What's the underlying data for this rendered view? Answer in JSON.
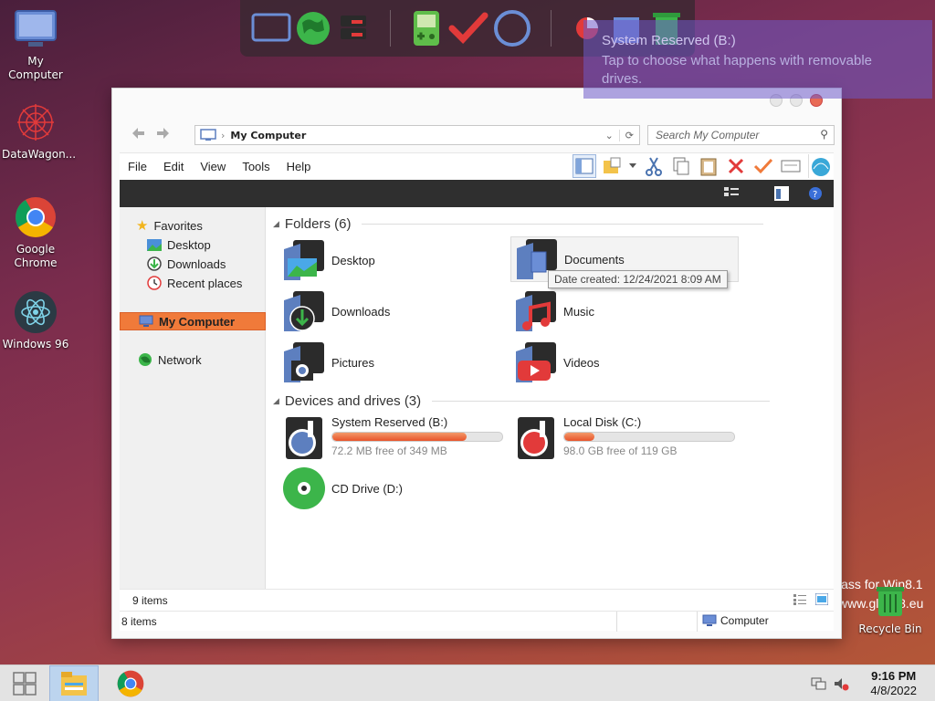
{
  "desktop": {
    "icons": [
      {
        "label": "My Computer",
        "icon": "monitor-icon"
      },
      {
        "label": "DataWagon...",
        "icon": "datawagon-icon"
      },
      {
        "label": "Google Chrome",
        "icon": "chrome-icon"
      },
      {
        "label": "Windows 96",
        "icon": "atom-icon"
      }
    ],
    "recycle_bin": "Recycle Bin",
    "watermark_line1": "lass for Win8.1",
    "watermark_line2": "www.glass8.eu"
  },
  "dock": {
    "items": [
      "monitor-icon",
      "globe-icon",
      "drive-icon",
      "gameboy-icon",
      "checkmark-icon",
      "circle-icon",
      "pie-icon",
      "cube-icon",
      "trash-icon"
    ]
  },
  "notification": {
    "title": "System Reserved (B:)",
    "body": "Tap to choose what happens with removable drives."
  },
  "window": {
    "breadcrumb": "My Computer",
    "search_placeholder": "Search My Computer",
    "menu": [
      "File",
      "Edit",
      "View",
      "Tools",
      "Help"
    ],
    "nav": {
      "favorites": "Favorites",
      "desktop": "Desktop",
      "downloads": "Downloads",
      "recent": "Recent places",
      "my_computer": "My Computer",
      "network": "Network"
    },
    "folders_header": "Folders (6)",
    "folders": [
      {
        "name": "Desktop",
        "icon": "desktop-folder-icon"
      },
      {
        "name": "Documents",
        "icon": "documents-folder-icon"
      },
      {
        "name": "Downloads",
        "icon": "downloads-folder-icon"
      },
      {
        "name": "Music",
        "icon": "music-folder-icon"
      },
      {
        "name": "Pictures",
        "icon": "pictures-folder-icon"
      },
      {
        "name": "Videos",
        "icon": "videos-folder-icon"
      }
    ],
    "tooltip": "Date created: 12/24/2021 8:09 AM",
    "devices_header": "Devices and drives (3)",
    "drives": [
      {
        "name": "System Reserved (B:)",
        "free": "72.2 MB free of 349 MB",
        "used_fraction": 0.79
      },
      {
        "name": "Local Disk (C:)",
        "free": "98.0 GB free of 119 GB",
        "used_fraction": 0.18
      }
    ],
    "cd_drive": "CD Drive (D:)",
    "status_items_top": "9 items",
    "status_items_bottom": "8 items",
    "status_location": "Computer"
  },
  "taskbar": {
    "time": "9:16 PM",
    "date": "4/8/2022"
  },
  "colors": {
    "accent_orange": "#f07a3a",
    "selection_blue": "#dfe8f5"
  }
}
